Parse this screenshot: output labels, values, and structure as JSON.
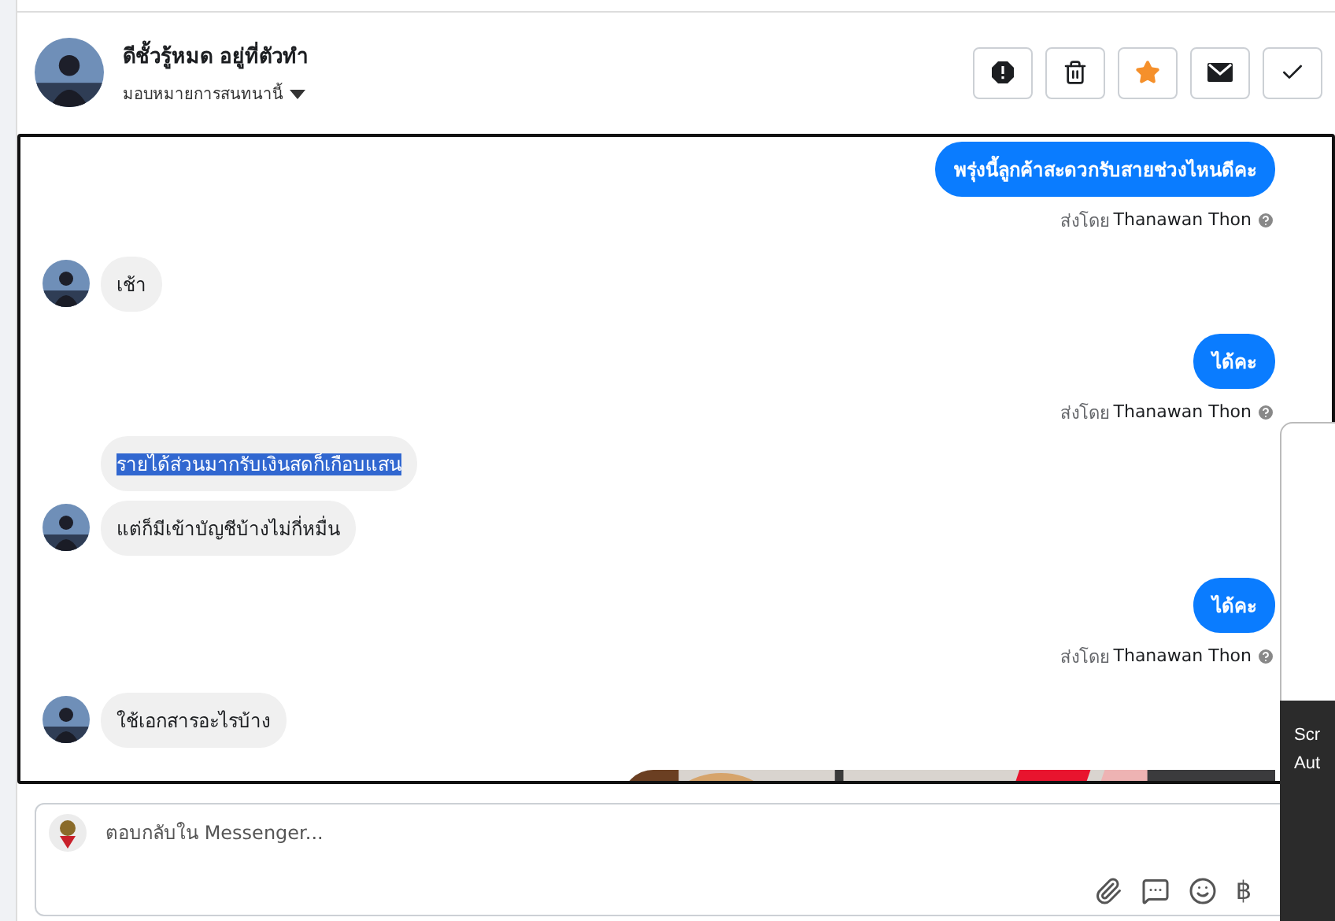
{
  "header": {
    "name": "ดีชั้วรู้หมด อยู่ที่ตัวทำ",
    "subtitle": "มอบหมายการสนทนานี้",
    "actions": [
      {
        "kind": "alert",
        "highlighted": false
      },
      {
        "kind": "trash",
        "highlighted": false
      },
      {
        "kind": "star",
        "highlighted": true
      },
      {
        "kind": "mail",
        "highlighted": false
      },
      {
        "kind": "check",
        "highlighted": false
      }
    ]
  },
  "messages": [
    {
      "kind": "outgoing",
      "text": "พรุ่งนี้ลูกค้าสะดวกรับสายช่วงไหนดีคะ",
      "sent_label": "ส่งโดย",
      "sender": "Thanawan Thon"
    },
    {
      "kind": "incoming",
      "text": "เช้า",
      "avatar": true,
      "highlighted": false
    },
    {
      "kind": "outgoing",
      "text": "ได้คะ",
      "sent_label": "ส่งโดย",
      "sender": "Thanawan Thon"
    },
    {
      "kind": "incoming",
      "text": "รายได้ส่วนมากรับเงินสดก็เกือบแสน",
      "avatar": false,
      "highlighted": true
    },
    {
      "kind": "incoming",
      "text": "แต่ก็มีเข้าบัญชีบ้างไม่กี่หมื่น",
      "avatar": true,
      "highlighted": false
    },
    {
      "kind": "outgoing",
      "text": "ได้คะ",
      "sent_label": "ส่งโดย",
      "sender": "Thanawan Thon"
    },
    {
      "kind": "incoming",
      "text": "ใช้เอกสารอะไรบ้าง",
      "avatar": true,
      "highlighted": false
    },
    {
      "kind": "picture"
    }
  ],
  "composer": {
    "placeholder": "ตอบกลับใน Messenger...",
    "currency": "฿"
  },
  "toast": {
    "lines": [
      "Scr",
      "Aut"
    ]
  }
}
